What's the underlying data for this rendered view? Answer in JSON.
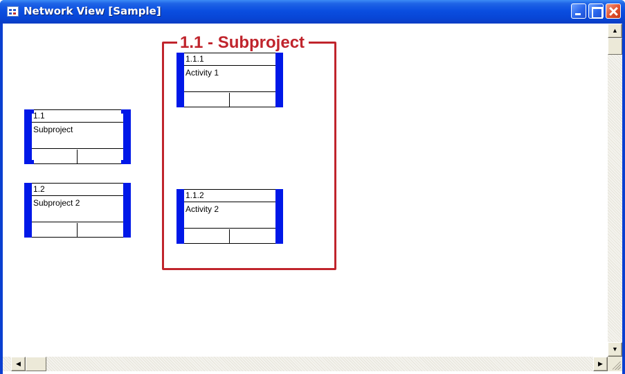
{
  "window": {
    "title": "Network View [Sample]",
    "icon": "network-view-icon",
    "controls": [
      "minimize-icon",
      "maximize-icon",
      "close-icon"
    ]
  },
  "colors": {
    "titlebar": "#0a4ee0",
    "node_bar": "#0018e8",
    "group_border": "#c0242c"
  },
  "nodes": [
    {
      "id": "1.1",
      "name": "Subproject",
      "type": "summary"
    },
    {
      "id": "1.2",
      "name": "Subproject 2",
      "type": "task"
    },
    {
      "id": "1.1.1",
      "name": "Activity 1",
      "type": "task"
    },
    {
      "id": "1.1.2",
      "name": "Activity 2",
      "type": "task"
    }
  ],
  "group": {
    "title": "1.1 - Subproject"
  },
  "scrollbars": {
    "vertical": {
      "up_icon": "arrow-up-icon",
      "down_icon": "arrow-down-icon"
    },
    "horizontal": {
      "left_icon": "arrow-left-icon",
      "right_icon": "arrow-right-icon"
    }
  }
}
